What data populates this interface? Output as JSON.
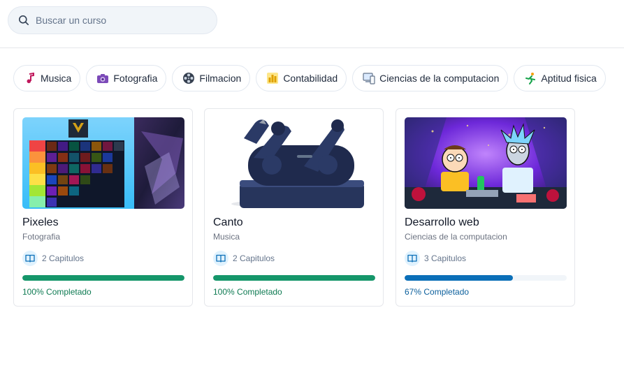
{
  "search": {
    "placeholder": "Buscar un curso",
    "value": ""
  },
  "categories": [
    {
      "label": "Musica",
      "icon": "music-note-icon"
    },
    {
      "label": "Fotografia",
      "icon": "camera-icon"
    },
    {
      "label": "Filmacion",
      "icon": "film-reel-icon"
    },
    {
      "label": "Contabilidad",
      "icon": "bar-chart-icon"
    },
    {
      "label": "Ciencias de la computacion",
      "icon": "computer-icon"
    },
    {
      "label": "Aptitud fisica",
      "icon": "runner-icon"
    }
  ],
  "courses": [
    {
      "title": "Pixeles",
      "category": "Fotografia",
      "chapters": "2 Capitulos",
      "progress_text": "100% Completado",
      "progress": 1.0,
      "progress_color": "#15966a",
      "image": "game-tier-list-image"
    },
    {
      "title": "Canto",
      "category": "Musica",
      "chapters": "2 Capitulos",
      "progress_text": "100% Completado",
      "progress": 1.0,
      "progress_color": "#15966a",
      "image": "wireless-earbuds-case-image"
    },
    {
      "title": "Desarrollo web",
      "category": "Ciencias de la computacion",
      "chapters": "3 Capitulos",
      "progress_text": "67% Completado",
      "progress": 0.67,
      "progress_color": "#0b6fb8",
      "image": "cartoon-characters-image"
    }
  ]
}
